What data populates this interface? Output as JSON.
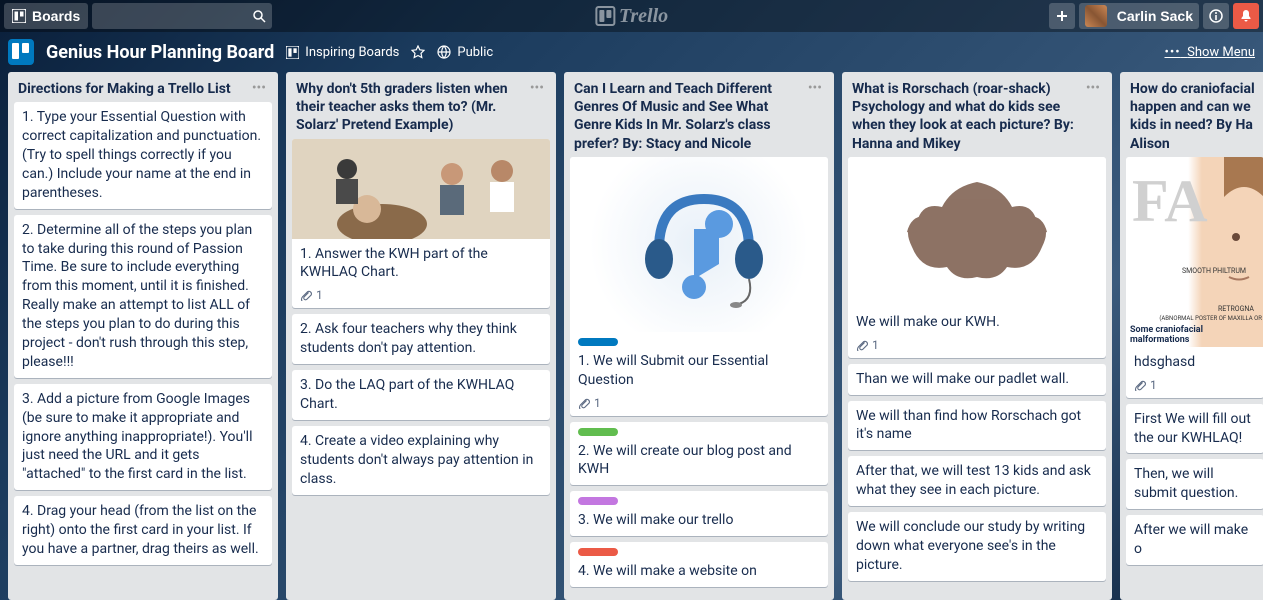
{
  "header": {
    "boards_label": "Boards",
    "logo_text": "Trello",
    "user_name": "Carlin Sack"
  },
  "board_header": {
    "title": "Genius Hour Planning Board",
    "inspiring": "Inspiring Boards",
    "visibility": "Public",
    "show_menu": "Show Menu"
  },
  "lists": [
    {
      "title": "Directions for Making a Trello List",
      "cards": [
        {
          "text": "1. Type your Essential Question with correct capitalization and punctuation. (Try to spell things correctly if you can.) Include your name at the end in parentheses."
        },
        {
          "text": "2. Determine all of the steps you plan to take during this round of Passion Time. Be sure to include everything from this moment, until it is finished. Really make an attempt to list ALL of the steps you plan to do during this project - don't rush through this step, please!!!"
        },
        {
          "text": "3. Add a picture from Google Images (be sure to make it appropriate and ignore anything inappropriate!). You'll just need the URL and it gets \"attached\" to the first card in the list."
        },
        {
          "text": "4. Drag your head (from the list on the right) onto the first card in your list. If you have a partner, drag theirs as well."
        }
      ]
    },
    {
      "title": "Why don't 5th graders listen when their teacher asks them to? (Mr. Solarz' Pretend Example)",
      "cover": "classroom",
      "cards": [
        {
          "text": "1. Answer the KWH part of the KWHLAQ Chart.",
          "attach": "1"
        },
        {
          "text": "2. Ask four teachers why they think students don't pay attention."
        },
        {
          "text": "3. Do the LAQ part of the KWHLAQ Chart."
        },
        {
          "text": "4. Create a video explaining why students don't always pay attention in class."
        }
      ]
    },
    {
      "title": "Can I Learn and Teach Different Genres Of Music and See What Genre Kids In Mr. Solarz's class prefer? By: Stacy and Nicole",
      "cover": "headphones",
      "cards": [
        {
          "label": "blue",
          "text": "1. We will Submit our Essential Question",
          "attach": "1"
        },
        {
          "label": "green",
          "text": "2. We will create our blog post and KWH"
        },
        {
          "label": "purple",
          "text": "3. We will make our trello"
        },
        {
          "label": "red",
          "text": "4. We will make a website on"
        }
      ]
    },
    {
      "title": "What is Rorschach (roar-shack) Psychology and what do kids see when they look at each picture? By: Hanna and Mikey",
      "cover": "rorschach",
      "cards": [
        {
          "text": "We will make our KWH.",
          "attach": "1"
        },
        {
          "text": "Than we will make our padlet wall."
        },
        {
          "text": "We will than find how Rorschach got it's name"
        },
        {
          "text": "After that, we will test 13 kids and ask what they see in each picture."
        },
        {
          "text": "We will conclude our study by writing down what everyone see's in the picture."
        }
      ]
    },
    {
      "title": "How do craniofacial happen and can we kids in need? By Ha Alison",
      "cover": "face",
      "cover_caption": "Some craniofacial malformations",
      "cover_labels": {
        "smooth": "SMOOTH PHILTRUM",
        "retro": "RETROGNA",
        "sub": "(ABNORMAL POSTER OF MAXILLA OR"
      },
      "cards": [
        {
          "text": "hdsghasd",
          "attach": "1"
        },
        {
          "text": "First We will fill out the our KWHLAQ!"
        },
        {
          "text": "Then, we will submit question."
        },
        {
          "text": "After we will make o"
        }
      ]
    }
  ]
}
